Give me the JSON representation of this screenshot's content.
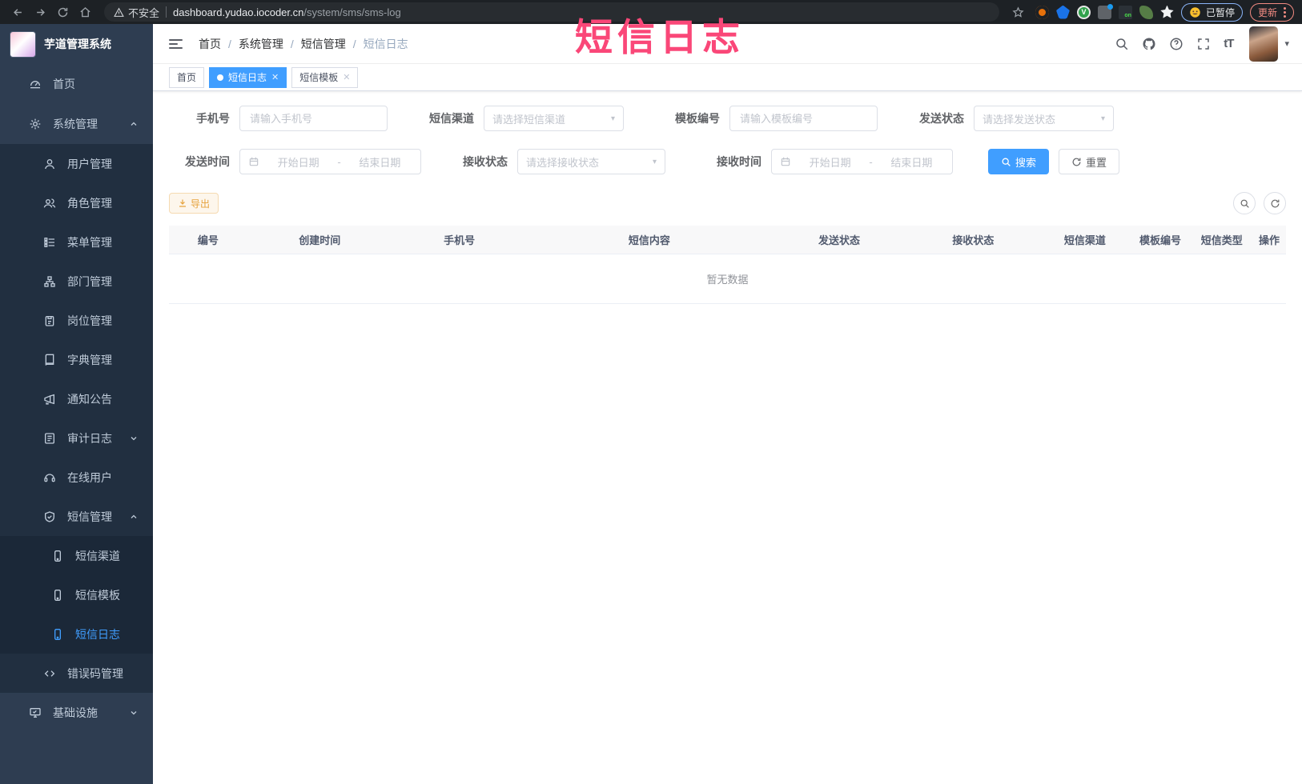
{
  "browser": {
    "security_chip": "不安全",
    "url_host": "dashboard.yudao.iocoder.cn",
    "url_path": "/system/sms/sms-log",
    "extension_on_badge": "on",
    "paused_badge": "已暂停",
    "update_button": "更新"
  },
  "overlay": {
    "title": "短信日志"
  },
  "sidebar": {
    "app_title": "芋道管理系统",
    "items": [
      {
        "label": "首页",
        "icon": "dashboard-icon",
        "level": 1
      },
      {
        "label": "系统管理",
        "icon": "gear-icon",
        "level": 1,
        "expanded": true
      },
      {
        "label": "用户管理",
        "icon": "user-icon",
        "level": 2
      },
      {
        "label": "角色管理",
        "icon": "users-icon",
        "level": 2
      },
      {
        "label": "菜单管理",
        "icon": "menu-tree-icon",
        "level": 2
      },
      {
        "label": "部门管理",
        "icon": "org-tree-icon",
        "level": 2
      },
      {
        "label": "岗位管理",
        "icon": "badge-icon",
        "level": 2
      },
      {
        "label": "字典管理",
        "icon": "book-icon",
        "level": 2
      },
      {
        "label": "通知公告",
        "icon": "megaphone-icon",
        "level": 2
      },
      {
        "label": "审计日志",
        "icon": "document-icon",
        "level": 2,
        "collapsed": true
      },
      {
        "label": "在线用户",
        "icon": "headset-icon",
        "level": 2
      },
      {
        "label": "短信管理",
        "icon": "shield-icon",
        "level": 2,
        "expanded": true
      },
      {
        "label": "短信渠道",
        "icon": "phone-icon",
        "level": 3
      },
      {
        "label": "短信模板",
        "icon": "phone-icon",
        "level": 3
      },
      {
        "label": "短信日志",
        "icon": "phone-icon",
        "level": 3,
        "active": true
      },
      {
        "label": "错误码管理",
        "icon": "code-icon",
        "level": 2
      },
      {
        "label": "基础设施",
        "icon": "monitor-icon",
        "level": 1,
        "collapsed": true
      }
    ]
  },
  "navbar": {
    "breadcrumb": [
      "首页",
      "系统管理",
      "短信管理",
      "短信日志"
    ],
    "separator": "/",
    "icons": [
      "search-icon",
      "github-icon",
      "help-icon",
      "fullscreen-icon",
      "font-size-icon"
    ],
    "font_size_glyph": "tT",
    "caret": "▾"
  },
  "tabs": [
    {
      "label": "首页",
      "active": false,
      "closable": false
    },
    {
      "label": "短信日志",
      "active": true,
      "closable": true
    },
    {
      "label": "短信模板",
      "active": false,
      "closable": true
    }
  ],
  "filters": {
    "phone": {
      "label": "手机号",
      "placeholder": "请输入手机号"
    },
    "channel": {
      "label": "短信渠道",
      "placeholder": "请选择短信渠道"
    },
    "template": {
      "label": "模板编号",
      "placeholder": "请输入模板编号"
    },
    "send_status": {
      "label": "发送状态",
      "placeholder": "请选择发送状态"
    },
    "send_time": {
      "label": "发送时间",
      "start_placeholder": "开始日期",
      "separator": "-",
      "end_placeholder": "结束日期"
    },
    "receive_status": {
      "label": "接收状态",
      "placeholder": "请选择接收状态"
    },
    "receive_time": {
      "label": "接收时间",
      "start_placeholder": "开始日期",
      "separator": "-",
      "end_placeholder": "结束日期"
    },
    "search_button": "搜索",
    "reset_button": "重置"
  },
  "toolbar": {
    "export_button": "导出"
  },
  "table": {
    "columns": [
      "编号",
      "创建时间",
      "手机号",
      "短信内容",
      "发送状态",
      "接收状态",
      "短信渠道",
      "模板编号",
      "短信类型",
      "操作"
    ],
    "empty_text": "暂无数据"
  },
  "colors": {
    "primary": "#409eff",
    "warning": "#e6a23c",
    "annotation_pink": "#fa4778",
    "sidebar_bg": "#2e3d51",
    "active_tab_bg": "#409eff"
  }
}
